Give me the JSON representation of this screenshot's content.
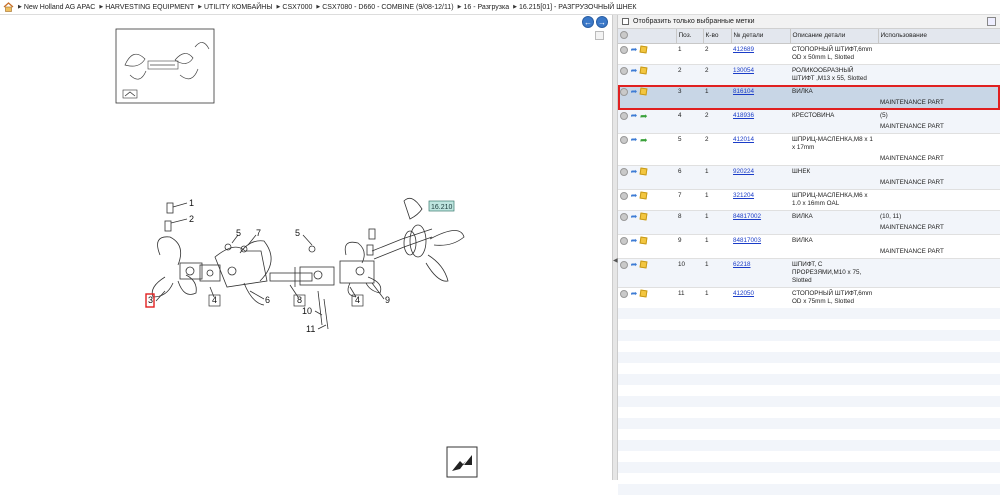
{
  "breadcrumb": [
    "New Holland AG APAC",
    "HARVESTING EQUIPMENT",
    "UTILITY КОМБАЙНЫ",
    "CSX7000",
    "CSX7080 - D660 - COMBINE (9/08-12/11)",
    "16 - Разгрузка",
    "16.215[01] - РАЗГРУЗОЧНЫЙ ШНЕК"
  ],
  "filter": {
    "label": "Отобразить только выбранные метки"
  },
  "table": {
    "headers": [
      "Поз.",
      "К-во",
      "№ детали",
      "Описание детали",
      "Использование"
    ],
    "rows": [
      {
        "pos": "1",
        "qty": "2",
        "part": "412689",
        "desc": "СТОПОРНЫЙ ШТИФТ,6mm OD x 50mm L, Slotted",
        "use": "",
        "sub": "",
        "icon2": "box",
        "selected": false
      },
      {
        "pos": "2",
        "qty": "2",
        "part": "130054",
        "desc": "РОЛИКООБРАЗНЫЙ ШТИФТ ,M13 x 55, Slotted",
        "use": "",
        "sub": "",
        "icon2": "box",
        "selected": false
      },
      {
        "pos": "3",
        "qty": "1",
        "part": "816104",
        "desc": "ВИЛКА",
        "use": "",
        "sub": "MAINTENANCE PART",
        "icon2": "box",
        "selected": true
      },
      {
        "pos": "4",
        "qty": "2",
        "part": "418936",
        "desc": "КРЕСТОВИНА",
        "use": "(5)",
        "sub": "MAINTENANCE PART",
        "icon2": "green",
        "selected": false
      },
      {
        "pos": "5",
        "qty": "2",
        "part": "412014",
        "desc": "ШПРИЦ-МАСЛЕНКА,M8 x 1 x 17mm",
        "use": "",
        "sub": "MAINTENANCE PART",
        "icon2": "green",
        "selected": false
      },
      {
        "pos": "6",
        "qty": "1",
        "part": "920224",
        "desc": "ШНЕК",
        "use": "",
        "sub": "MAINTENANCE PART",
        "icon2": "box",
        "selected": false
      },
      {
        "pos": "7",
        "qty": "1",
        "part": "321204",
        "desc": "ШПРИЦ-МАСЛЕНКА,M6 x 1.0 x 16mm OAL",
        "use": "",
        "sub": "",
        "icon2": "box",
        "selected": false
      },
      {
        "pos": "8",
        "qty": "1",
        "part": "84817002",
        "desc": "ВИЛКА",
        "use": "(10, 11)",
        "sub": "MAINTENANCE PART",
        "icon2": "box",
        "selected": false
      },
      {
        "pos": "9",
        "qty": "1",
        "part": "84817003",
        "desc": "ВИЛКА",
        "use": "",
        "sub": "MAINTENANCE PART",
        "icon2": "box",
        "selected": false
      },
      {
        "pos": "10",
        "qty": "1",
        "part": "62218",
        "desc": "ШПИФТ, С ПРОРЕЗЯМИ,M10 x 75, Slotted",
        "use": "",
        "sub": "",
        "icon2": "box",
        "selected": false
      },
      {
        "pos": "11",
        "qty": "1",
        "part": "412050",
        "desc": "СТОПОРНЫЙ ШТИФТ,6mm OD x 75mm L, Slotted",
        "use": "",
        "sub": "",
        "icon2": "box",
        "selected": false
      }
    ]
  },
  "diagram": {
    "ref_tag": "16.210",
    "callouts": [
      "1",
      "2",
      "5",
      "7",
      "5",
      "3",
      "4",
      "6",
      "8",
      "10",
      "11",
      "4",
      "9"
    ]
  },
  "colors": {
    "highlight": "#e02020",
    "link": "#1a3cc8",
    "selected_row": "#c8d6e6",
    "tag": "#bfe6e0"
  }
}
